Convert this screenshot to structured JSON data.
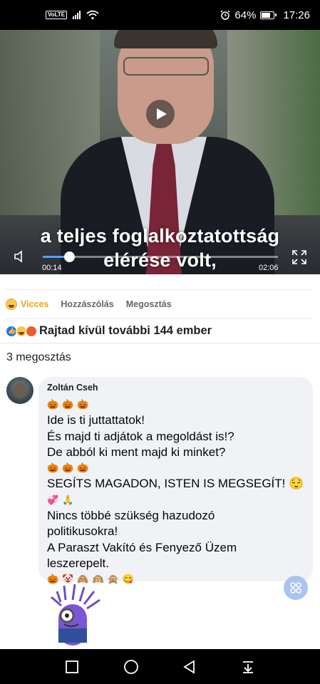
{
  "status_bar": {
    "volte": "VoLTE",
    "battery_percent": "64%",
    "time": "17:26"
  },
  "video": {
    "caption_line1": "a teljes foglalkoztatottság",
    "caption_line2": "elérése volt,",
    "current_time": "00:14",
    "duration": "02:06",
    "progress_fraction": 0.111
  },
  "actions": {
    "vicces": "Vicces",
    "comment": "Hozzászólás",
    "share": "Megosztás"
  },
  "reactions": {
    "summary": "Rajtad kívül további 144 ember"
  },
  "shares": {
    "count_text": "3 megosztás"
  },
  "comment": {
    "author": "Zoltán Cseh",
    "lines": {
      "l0": "🎃🎃🎃",
      "l1": "Ide is ti juttattatok!",
      "l2": "És majd ti adjátok a megoldást is!?",
      "l3": "De abból ki ment majd ki minket?",
      "l4": "🎃🎃🎃",
      "l5": "SEGÍTS MAGADON, ISTEN IS MEGSEGÍT! 😌",
      "l6": "💞🙏",
      "l7": "Nincs többé szükség hazudozó",
      "l8": "politikusokra!",
      "l9": "A Paraszt Vakító és Fenyező Üzem",
      "l10": "leszerepelt.",
      "l11": "🎃🤡🙈🙉🙊😋"
    }
  },
  "colors": {
    "accent_blue": "#1877f2",
    "vicces_yellow": "#f0a30a",
    "bubble_bg": "#f0f2f5"
  }
}
